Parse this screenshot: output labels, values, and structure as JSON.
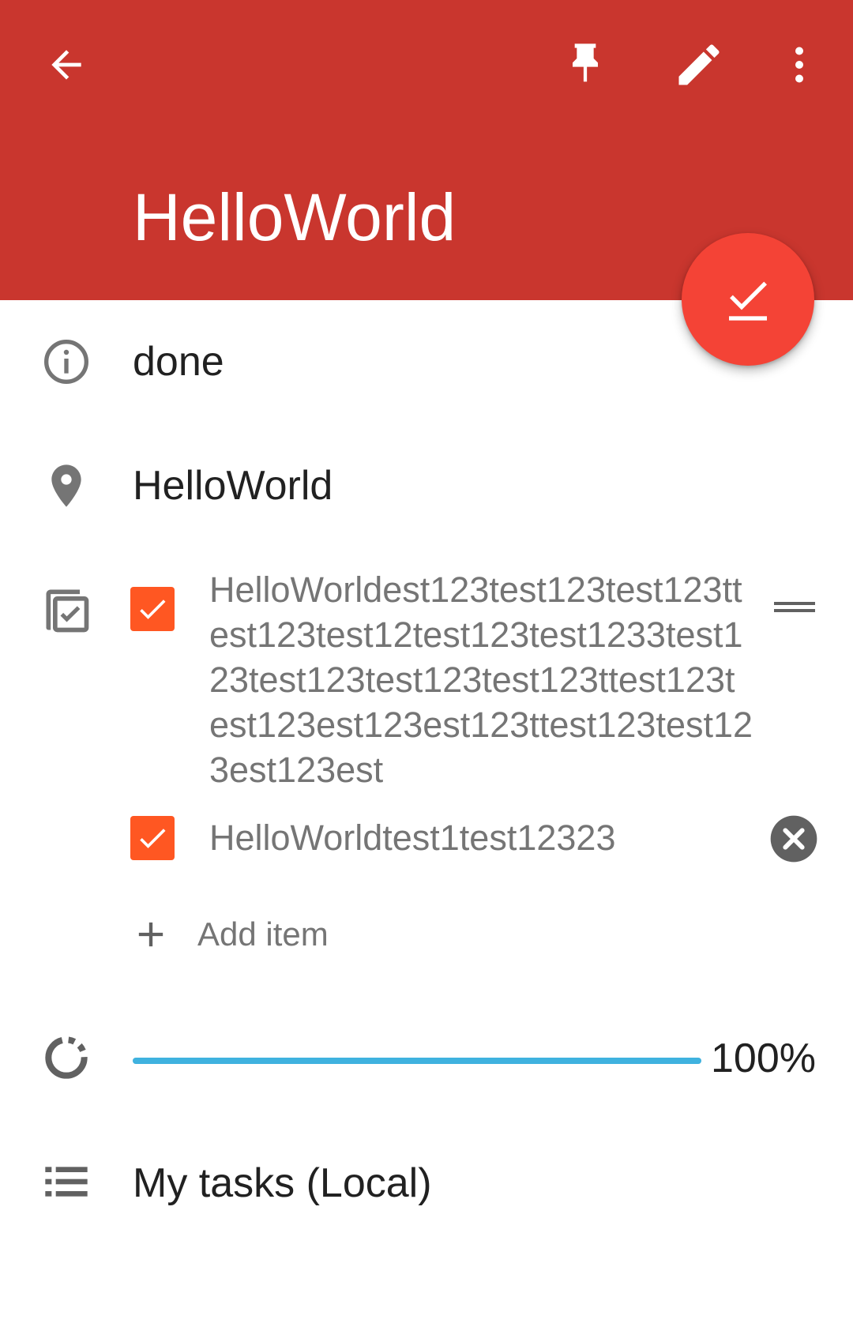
{
  "appbar": {
    "title": "HelloWorld",
    "back_icon": "arrow-back-icon",
    "pin_icon": "pin-icon",
    "edit_icon": "pencil-icon",
    "more_icon": "more-vert-icon",
    "color": "#c9362e"
  },
  "fab": {
    "icon": "check-done-icon",
    "color": "#f44336"
  },
  "status": {
    "icon": "info-icon",
    "value": "done"
  },
  "location": {
    "icon": "location-pin-icon",
    "value": "HelloWorld"
  },
  "checklist": {
    "icon": "checklist-icon",
    "items": [
      {
        "checked": true,
        "text": "HelloWorldest123test123test123ttest123test12test123test1233test123test123test123test123ttest123test123est123est123ttest123test123est123est",
        "action_icon": "drag-handle-icon"
      },
      {
        "checked": true,
        "text": "HelloWorldtest1test12323",
        "action_icon": "clear-circle-icon"
      }
    ],
    "add_item_label": "Add item",
    "checkbox_color": "#ff5722"
  },
  "progress": {
    "icon": "progress-circle-icon",
    "percent": 100,
    "label": "100%",
    "color": "#3fb2df"
  },
  "list": {
    "icon": "list-icon",
    "name": "My tasks (Local)"
  }
}
